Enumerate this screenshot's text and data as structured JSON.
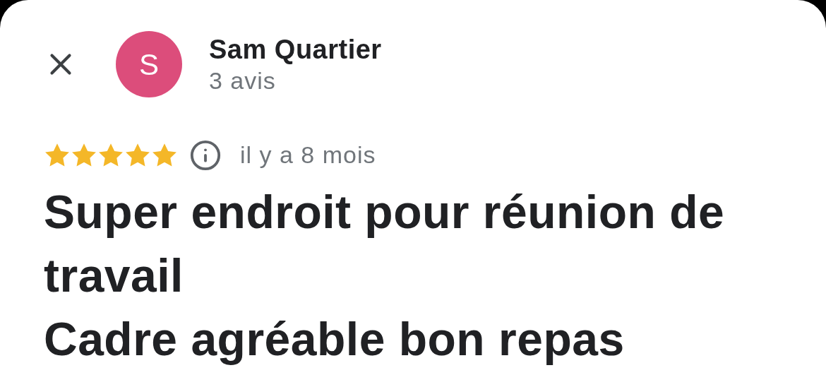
{
  "reviewer": {
    "initial": "S",
    "name": "Sam Quartier",
    "review_count": "3 avis",
    "color": "#dc4d7b"
  },
  "review": {
    "stars": 5,
    "time": "il y a 8 mois",
    "lines": [
      "Super endroit pour réunion de travail",
      "Cadre agréable bon repas"
    ]
  }
}
